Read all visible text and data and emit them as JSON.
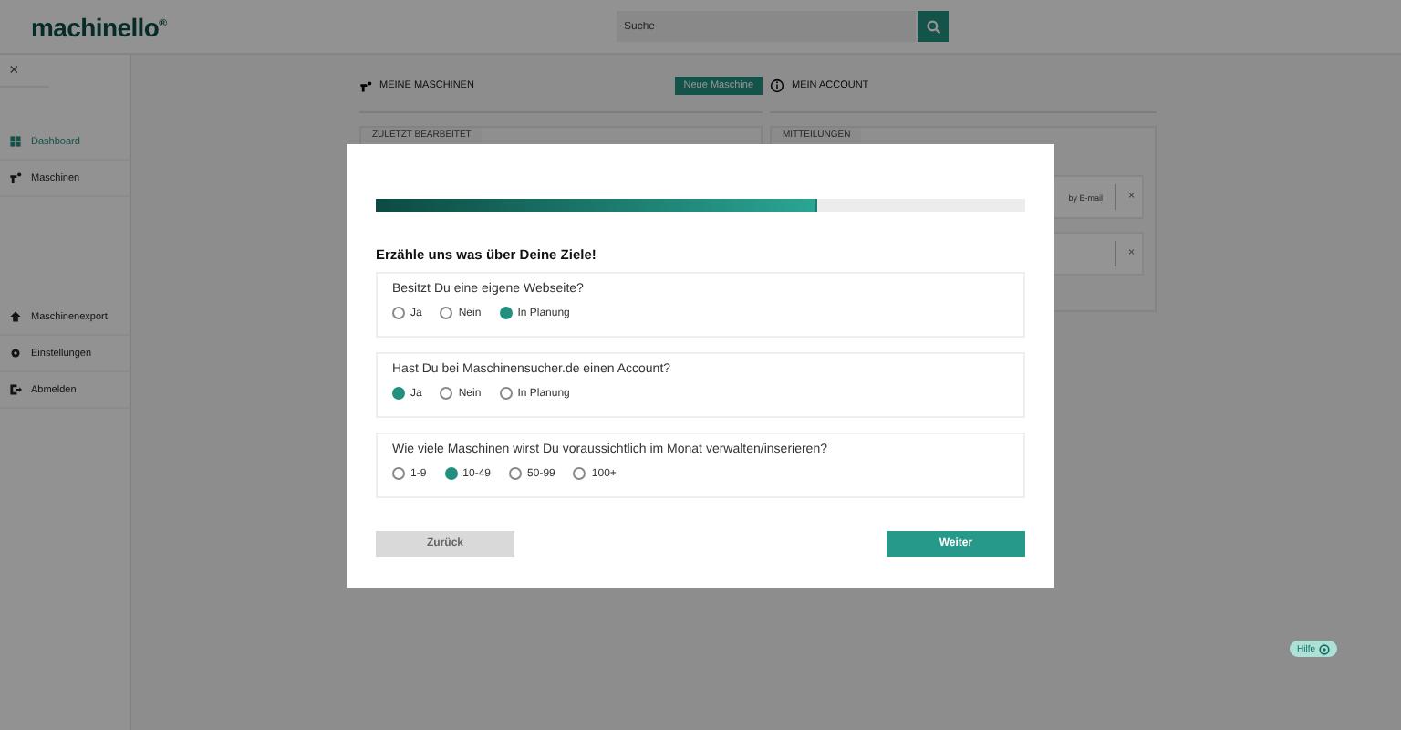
{
  "header": {
    "logo": "machinello$^{®}$",
    "search": {
      "placeholder": "Suche"
    }
  },
  "sidebar": {
    "close": "×",
    "top_items": [
      {
        "label": "Dashboard",
        "selected": true
      },
      {
        "label": "Maschinen",
        "selected": false
      }
    ],
    "bottom_items": [
      {
        "label": "Maschinenexport",
        "selected": false
      },
      {
        "label": "Einstellungen",
        "selected": false
      },
      {
        "label": "Abmelden",
        "selected": false
      }
    ]
  },
  "sections": [
    {
      "title": "MEINE MASCHINEN",
      "button": "Neue Maschine",
      "card_title": "ZULETZT BEARBEITET"
    },
    {
      "title": "MEIN ACCOUNT",
      "card_title": "MITTEILUNGEN",
      "notifications": [
        {
          "text": "by E-mail",
          "close": "×"
        },
        {
          "close": "×"
        }
      ]
    }
  ],
  "modal": {
    "progress": {
      "level": 0.68
    },
    "title": "Erzähle uns was über Deine Ziele!",
    "questions": [
      {
        "text": "Besitzt Du eine eigene Webseite?",
        "options": [
          {
            "label": "Ja",
            "selected": false
          },
          {
            "label": "Nein",
            "selected": false
          },
          {
            "label": "In Planung",
            "selected": true
          }
        ]
      },
      {
        "text": "Hast Du bei Maschinensucher.de einen Account?",
        "options": [
          {
            "label": "Ja",
            "selected": true
          },
          {
            "label": "Nein",
            "selected": false
          },
          {
            "label": "In Planung",
            "selected": false
          }
        ]
      },
      {
        "text": "Wie viele Maschinen wirst Du voraussichtlich im Monat verwalten/inserieren?",
        "options": [
          {
            "label": "1-9",
            "selected": false
          },
          {
            "label": "10-49",
            "selected": true
          },
          {
            "label": "50-99",
            "selected": false
          },
          {
            "label": "100+",
            "selected": false
          }
        ]
      }
    ],
    "back_button": "Zurück",
    "next_button": "Weiter"
  },
  "help_button": "Hilfe"
}
